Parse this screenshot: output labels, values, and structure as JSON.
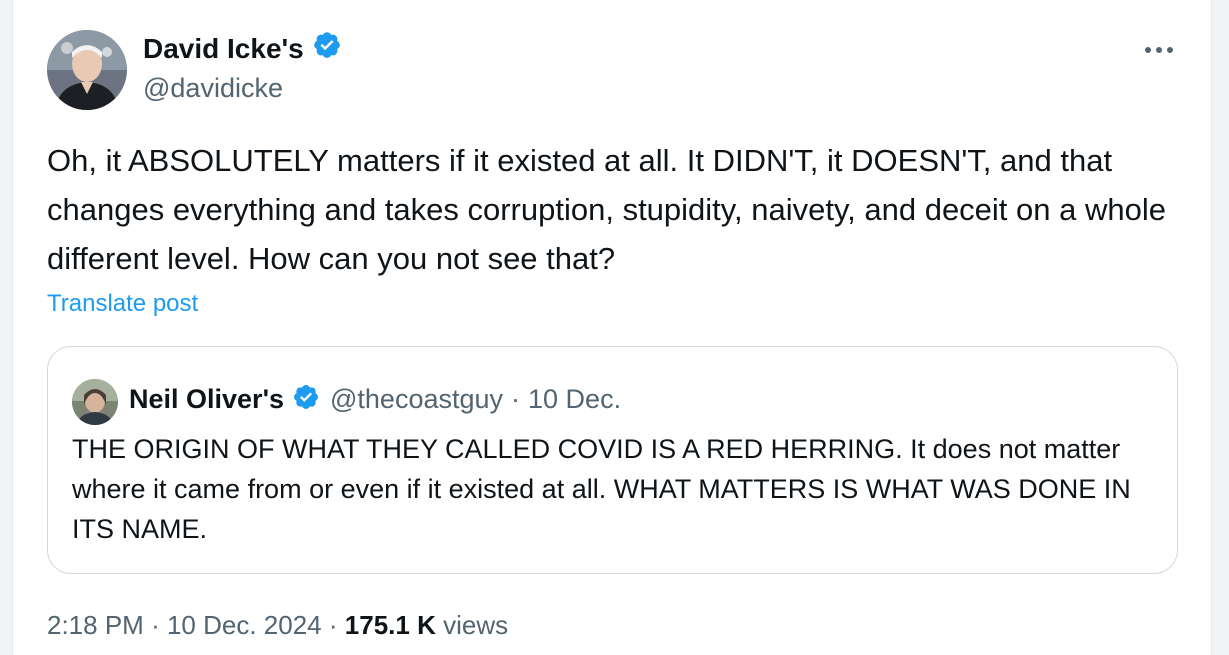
{
  "author": {
    "name": "David Icke's",
    "handle": "@davidicke",
    "verified": true
  },
  "more_icon": "more-horizontal-icon",
  "tweet": {
    "text": "Oh, it ABSOLUTELY matters if it existed at all. It DIDN'T, it DOESN'T, and that changes everything and takes corruption, stupidity, naivety, and deceit on a whole different level. How can you not see that?",
    "translate_label": "Translate post"
  },
  "quoted": {
    "name": "Neil Oliver's",
    "handle": "@thecoastguy",
    "date": "10 Dec.",
    "separator": "·",
    "text": "THE ORIGIN OF WHAT THEY CALLED COVID IS A RED HERRING. It does not matter where it came from or even if it existed at all. WHAT MATTERS IS WHAT WAS DONE IN ITS NAME."
  },
  "footer": {
    "time": "2:18 PM",
    "date": "10 Dec. 2024",
    "separator": "·",
    "views_count": "175.1 K",
    "views_label": "views"
  },
  "colors": {
    "verified": "#1d9bf0",
    "link": "#1d9bf0",
    "secondary_text": "#536471",
    "primary_text": "#0f1419"
  }
}
